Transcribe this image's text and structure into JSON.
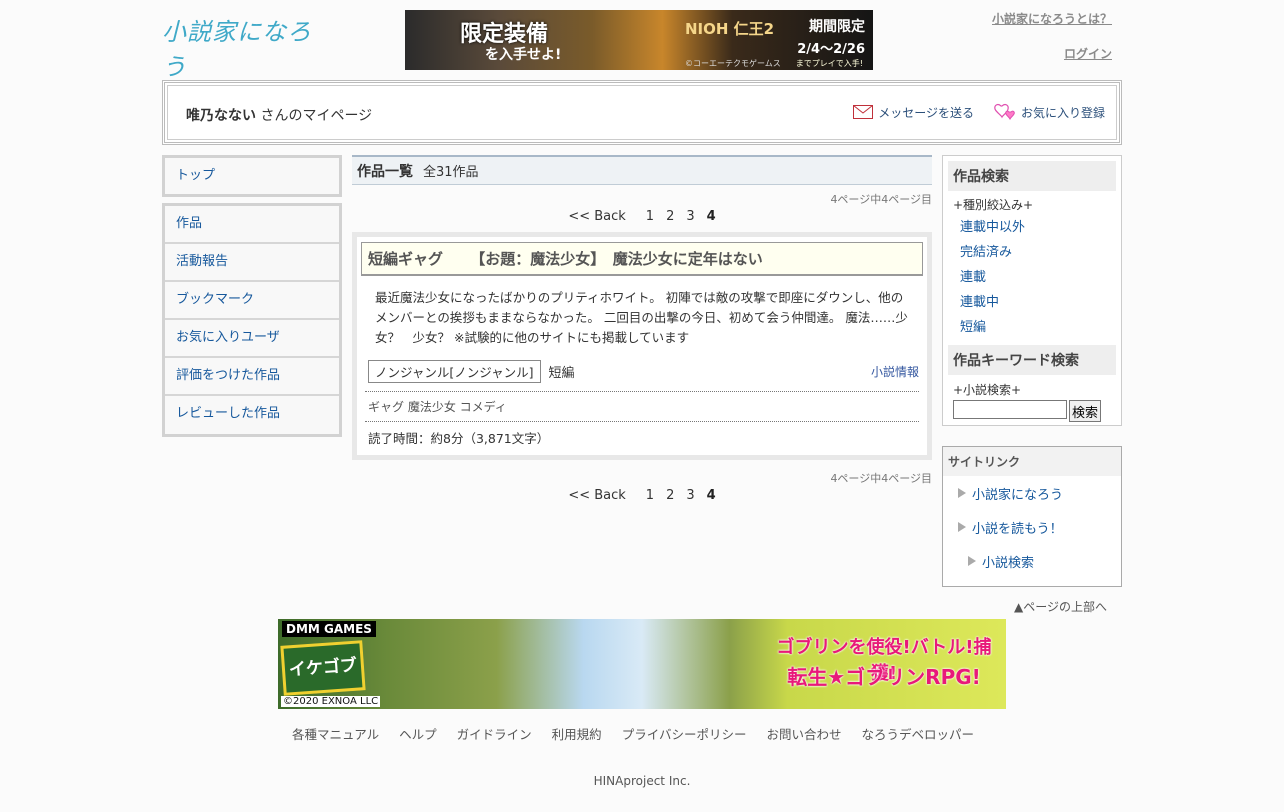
{
  "header": {
    "logo_text": "小説家になろう",
    "about_link": "小説家になろうとは？",
    "login_link": "ログイン",
    "banner": {
      "headline": "限定装備",
      "subline": "を入手せよ!",
      "game": "NIOH 仁王2",
      "period_label": "期間限定",
      "period": "2/4～2/26",
      "play_note": "までプレイで入手!",
      "copyright": "©コーエーテクモゲームス"
    }
  },
  "userbar": {
    "username": "唯乃なない",
    "suffix": "さんのマイページ",
    "message_label": "メッセージを送る",
    "favorite_label": "お気に入り登録"
  },
  "left_nav": {
    "top_label": "トップ",
    "items": [
      "作品",
      "活動報告",
      "ブックマーク",
      "お気に入りユーザ",
      "評価をつけた作品",
      "レビューした作品"
    ]
  },
  "main": {
    "heading": "作品一覧",
    "count": "全31作品",
    "page_info": "4ページ中4ページ目",
    "pager": {
      "back": "<< Back",
      "pages": [
        "1",
        "2",
        "3",
        "4"
      ],
      "current": "4"
    },
    "work": {
      "genre": "短編ギャグ",
      "title": "【お題：魔法少女】　魔法少女に定年はない",
      "description": "最近魔法少女になったばかりのプリティホワイト。 初陣では敵の攻撃で即座にダウンし、他のメンバーとの挨拶もままならなかった。 二回目の出撃の今日、初めて会う仲間達。 魔法……少女？　少女？ ※試験的に他のサイトにも掲載しています",
      "genre_box": "ノンジャンル[ノンジャンル]",
      "type": "短編",
      "info_link": "小説情報",
      "tags": "ギャグ 魔法少女 コメディ",
      "read_time": "読了時間：約8分（3,871文字）"
    }
  },
  "search": {
    "heading": "作品検索",
    "filter_label": "+種別絞込み+",
    "options": [
      "連載中以外",
      "完結済み",
      "連載",
      "連載中",
      "短編"
    ],
    "keyword_heading": "作品キーワード検索",
    "keyword_label": "+小説検索+",
    "input_value": "",
    "button_label": "検索"
  },
  "sitelink": {
    "heading": "サイトリンク",
    "items": [
      "小説家になろう",
      "小説を読もう！",
      "小説検索"
    ]
  },
  "pagetop": "▲ページの上部へ",
  "bottom_banner": {
    "brand": "DMM GAMES",
    "logo": "イケゴブ",
    "copyright": "©2020 EXNOA LLC",
    "tagline1": "ゴブリンを使役!バトル!捕獲!",
    "tagline2": "転生★ゴブリンRPG!"
  },
  "footer": {
    "links": [
      "各種マニュアル",
      "ヘルプ",
      "ガイドライン",
      "利用規約",
      "プライバシーポリシー",
      "お問い合わせ",
      "なろうデベロッパー"
    ],
    "copyright": "HINAproject Inc."
  }
}
